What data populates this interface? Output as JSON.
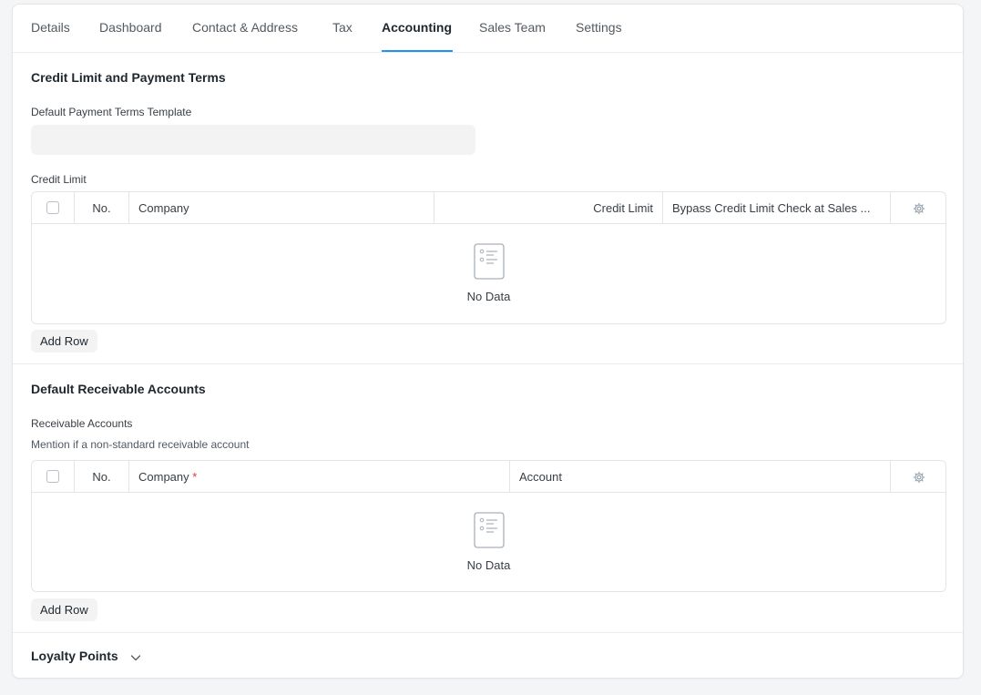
{
  "tabs": [
    {
      "label": "Details"
    },
    {
      "label": "Dashboard"
    },
    {
      "label": "Contact & Address"
    },
    {
      "label": "Tax"
    },
    {
      "label": "Accounting"
    },
    {
      "label": "Sales Team"
    },
    {
      "label": "Settings"
    }
  ],
  "active_tab": "Accounting",
  "credit_section": {
    "title": "Credit Limit and Payment Terms",
    "payment_terms_label": "Default Payment Terms Template",
    "payment_terms_value": "",
    "credit_limit_label": "Credit Limit",
    "grid": {
      "columns": [
        "No.",
        "Company",
        "Credit Limit",
        "Bypass Credit Limit Check at Sales ..."
      ],
      "empty_text": "No Data",
      "add_row_label": "Add Row"
    }
  },
  "receivable_section": {
    "title": "Default Receivable Accounts",
    "field_label": "Receivable Accounts",
    "field_desc": "Mention if a non-standard receivable account",
    "grid": {
      "columns": [
        "No.",
        "Company",
        "Account"
      ],
      "required_mark": "*",
      "empty_text": "No Data",
      "add_row_label": "Add Row"
    }
  },
  "loyalty_section": {
    "title": "Loyalty Points",
    "collapsed": true
  },
  "icons": {
    "settings": "gear-icon",
    "empty": "document-list-icon",
    "collapse": "chevron-down-icon"
  },
  "colors": {
    "accent": "#2490ef",
    "required": "#e03636"
  }
}
